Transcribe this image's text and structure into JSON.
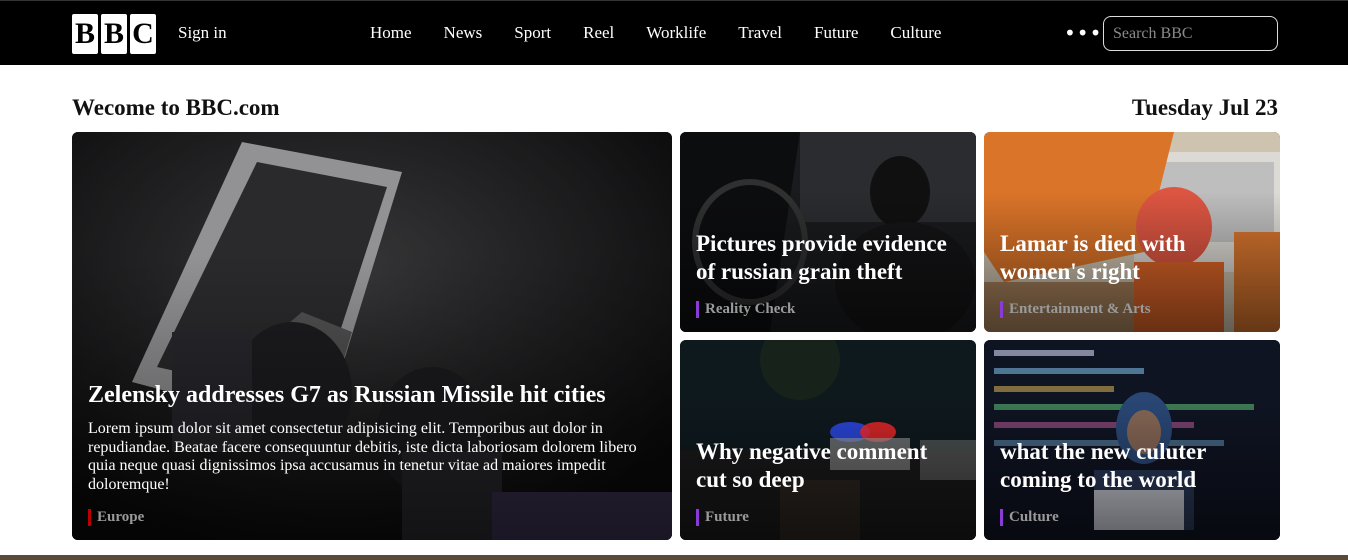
{
  "header": {
    "logo_letters": [
      "B",
      "B",
      "C"
    ],
    "sign_in": "Sign in",
    "nav": [
      "Home",
      "News",
      "Sport",
      "Reel",
      "Worklife",
      "Travel",
      "Future",
      "Culture"
    ],
    "more": "•••",
    "search_placeholder": "Search BBC"
  },
  "intro": {
    "welcome": "Wecome to BBC.com",
    "date": "Tuesday Jul 23"
  },
  "colors": {
    "accent_red": "#b80000",
    "accent_purple": "#8a3bd6"
  },
  "stories": {
    "main": {
      "title": "Zelensky addresses G7 as Russian Missile hit cities",
      "summary": "Lorem ipsum dolor sit amet consectetur adipisicing elit. Temporibus aut dolor in repudiandae. Beatae facere consequuntur debitis, iste dicta laboriosam dolorem libero quia neque quasi dignissimos ipsa accusamus in tenetur vitae ad maiores impedit doloremque!",
      "tag": "Europe"
    },
    "s1": {
      "title": "Pictures provide evidence of russian grain theft",
      "tag": "Reality Check"
    },
    "s2": {
      "title": "Lamar is died with women's right",
      "tag": "Entertainment & Arts"
    },
    "s3": {
      "title": "Why negative comment cut so deep",
      "tag": "Future"
    },
    "s4": {
      "title": "what the new culuter coming to the world",
      "tag": "Culture"
    }
  }
}
